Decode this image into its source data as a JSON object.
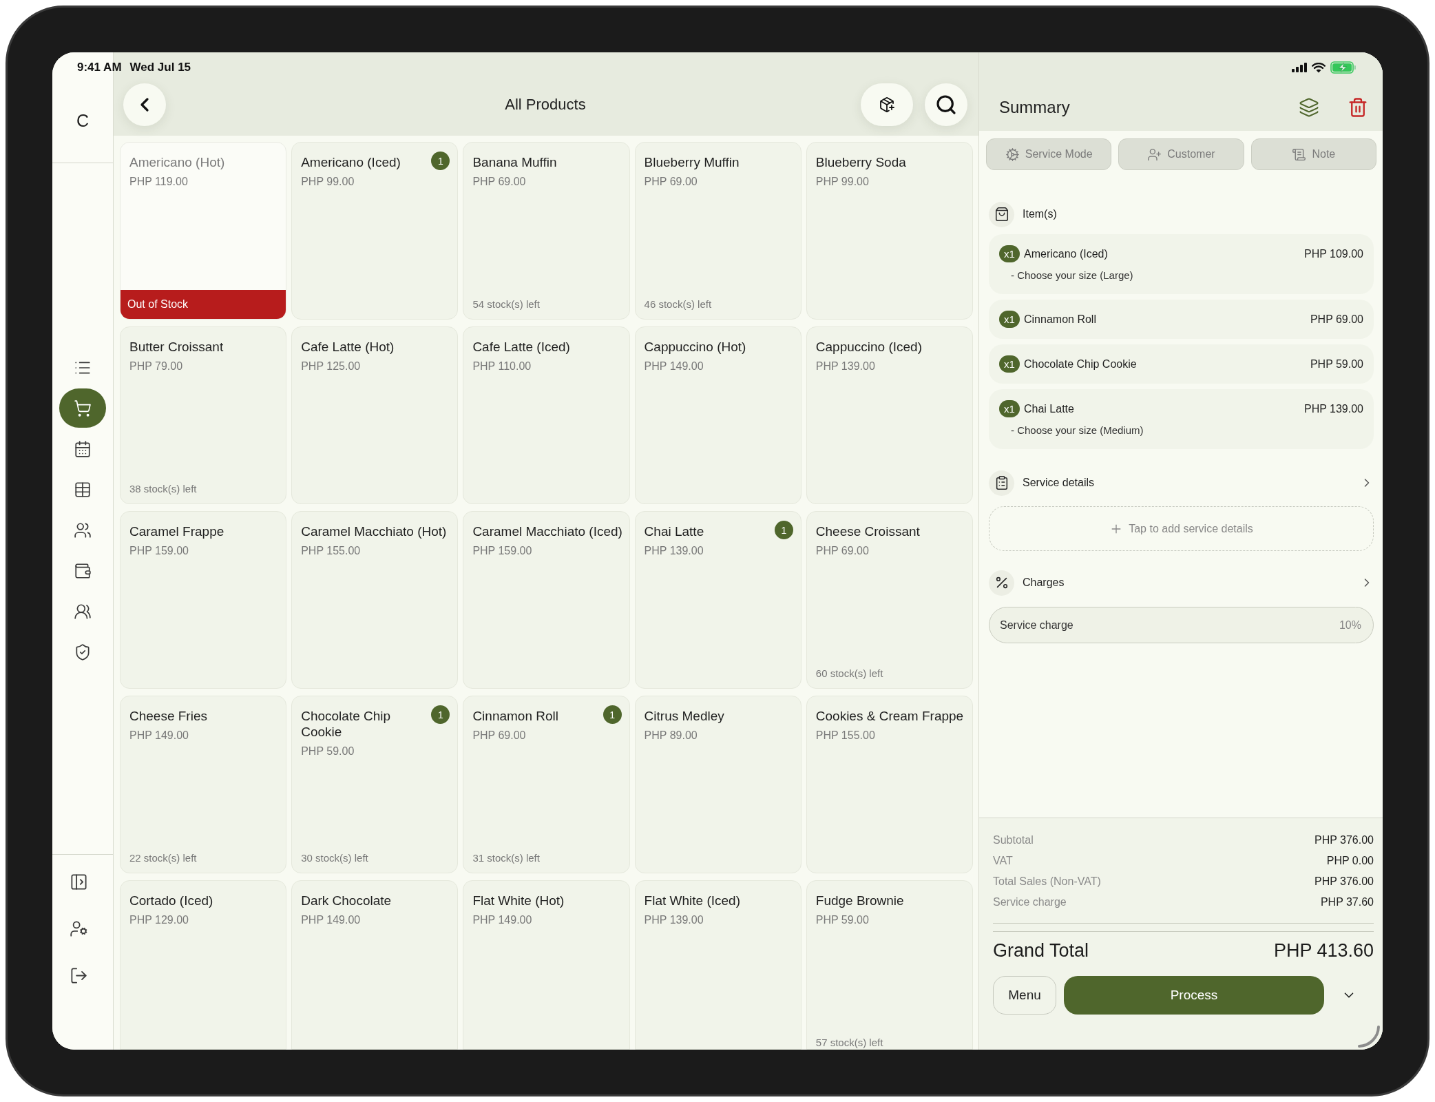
{
  "status_bar": {
    "time": "9:41 AM",
    "date": "Wed Jul 15"
  },
  "sidebar": {
    "logo": "C",
    "nav": [
      {
        "selected": false
      },
      {
        "selected": true
      },
      {
        "selected": false
      },
      {
        "selected": false
      },
      {
        "selected": false
      },
      {
        "selected": false
      },
      {
        "selected": false
      },
      {
        "selected": false
      }
    ]
  },
  "header": {
    "title": "All Products"
  },
  "products": [
    {
      "name": "Americano (Hot)",
      "price": "PHP 119.00",
      "stock": "Out of Stock",
      "out_of_stock": true
    },
    {
      "name": "Americano (Iced)",
      "price": "PHP 99.00",
      "count": "1",
      "out_of_stock": false
    },
    {
      "name": "Banana Muffin",
      "price": "PHP 69.00",
      "stock": "54 stock(s) left",
      "out_of_stock": false
    },
    {
      "name": "Blueberry Muffin",
      "price": "PHP 69.00",
      "stock": "46 stock(s) left",
      "out_of_stock": false
    },
    {
      "name": "Blueberry Soda",
      "price": "PHP 99.00",
      "out_of_stock": false
    },
    {
      "name": "Butter Croissant",
      "price": "PHP 79.00",
      "stock": "38 stock(s) left",
      "out_of_stock": false
    },
    {
      "name": "Cafe Latte (Hot)",
      "price": "PHP 125.00",
      "out_of_stock": false
    },
    {
      "name": "Cafe Latte (Iced)",
      "price": "PHP 110.00",
      "out_of_stock": false
    },
    {
      "name": "Cappuccino (Hot)",
      "price": "PHP 149.00",
      "out_of_stock": false
    },
    {
      "name": "Cappuccino (Iced)",
      "price": "PHP 139.00",
      "out_of_stock": false
    },
    {
      "name": "Caramel Frappe",
      "price": "PHP 159.00",
      "out_of_stock": false
    },
    {
      "name": "Caramel Macchiato (Hot)",
      "price": "PHP 155.00",
      "out_of_stock": false
    },
    {
      "name": "Caramel Macchiato (Iced)",
      "price": "PHP 159.00",
      "out_of_stock": false
    },
    {
      "name": "Chai Latte",
      "price": "PHP 139.00",
      "count": "1",
      "out_of_stock": false
    },
    {
      "name": "Cheese Croissant",
      "price": "PHP 69.00",
      "stock": "60 stock(s) left",
      "out_of_stock": false
    },
    {
      "name": "Cheese Fries",
      "price": "PHP 149.00",
      "stock": "22 stock(s) left",
      "out_of_stock": false
    },
    {
      "name": "Chocolate Chip Cookie",
      "price": "PHP 59.00",
      "count": "1",
      "stock": "30 stock(s) left",
      "out_of_stock": false
    },
    {
      "name": "Cinnamon Roll",
      "price": "PHP 69.00",
      "count": "1",
      "stock": "31 stock(s) left",
      "out_of_stock": false
    },
    {
      "name": "Citrus Medley",
      "price": "PHP 89.00",
      "out_of_stock": false
    },
    {
      "name": "Cookies & Cream Frappe",
      "price": "PHP 155.00",
      "out_of_stock": false
    },
    {
      "name": "Cortado (Iced)",
      "price": "PHP 129.00",
      "out_of_stock": false
    },
    {
      "name": "Dark Chocolate",
      "price": "PHP 149.00",
      "out_of_stock": false
    },
    {
      "name": "Flat White (Hot)",
      "price": "PHP 149.00",
      "out_of_stock": false
    },
    {
      "name": "Flat White (Iced)",
      "price": "PHP 139.00",
      "out_of_stock": false
    },
    {
      "name": "Fudge Brownie",
      "price": "PHP 59.00",
      "stock": "57 stock(s) left",
      "out_of_stock": false
    }
  ],
  "summary": {
    "title": "Summary",
    "modes": [
      "Service Mode",
      "Customer",
      "Note"
    ],
    "items_heading": "Item(s)",
    "items": [
      {
        "qty": "x1",
        "name": "Americano (Iced)",
        "price": "PHP 109.00",
        "option": "- Choose your size (Large)"
      },
      {
        "qty": "x1",
        "name": "Cinnamon Roll",
        "price": "PHP 69.00"
      },
      {
        "qty": "x1",
        "name": "Chocolate Chip Cookie",
        "price": "PHP 59.00"
      },
      {
        "qty": "x1",
        "name": "Chai Latte",
        "price": "PHP 139.00",
        "option": "- Choose your size (Medium)"
      }
    ],
    "service_details": {
      "heading": "Service details",
      "add_prompt": "Tap to add service details"
    },
    "charges": {
      "heading": "Charges",
      "rows": [
        {
          "name": "Service charge",
          "value": "10%"
        }
      ]
    },
    "totals": [
      {
        "label": "Subtotal",
        "value": "PHP 376.00"
      },
      {
        "label": "VAT",
        "value": "PHP 0.00"
      },
      {
        "label": "Total Sales (Non-VAT)",
        "value": "PHP 376.00"
      },
      {
        "label": "Service charge",
        "value": "PHP 37.60"
      }
    ],
    "grand_total": {
      "label": "Grand Total",
      "value": "PHP 413.60"
    },
    "actions": {
      "menu": "Menu",
      "process": "Process"
    }
  }
}
